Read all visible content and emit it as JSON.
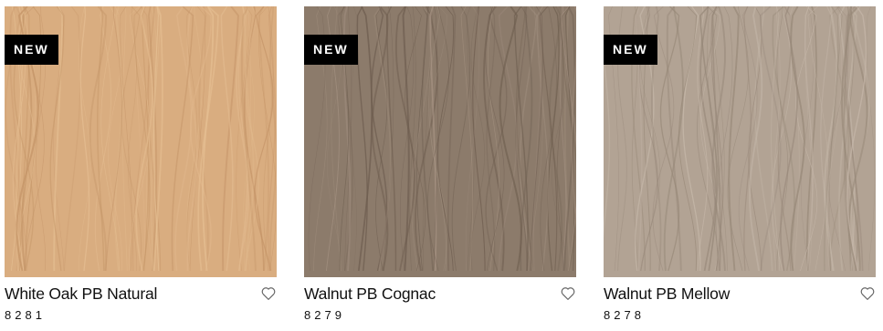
{
  "products": [
    {
      "badge": "NEW",
      "name": "White Oak PB Natural",
      "code": "8281",
      "swatch_color": "#d9ad80",
      "grain_color": "#c49467",
      "highlight_color": "#e6bf93",
      "favorite_icon": "heart-outline-icon"
    },
    {
      "badge": "NEW",
      "name": "Walnut PB Cognac",
      "code": "8279",
      "swatch_color": "#8c7b6b",
      "grain_color": "#6d5d4f",
      "highlight_color": "#a89585",
      "favorite_icon": "heart-outline-icon"
    },
    {
      "badge": "NEW",
      "name": "Walnut PB Mellow",
      "code": "8278",
      "swatch_color": "#b2a394",
      "grain_color": "#968778",
      "highlight_color": "#c6b8aa",
      "favorite_icon": "heart-outline-icon"
    }
  ]
}
